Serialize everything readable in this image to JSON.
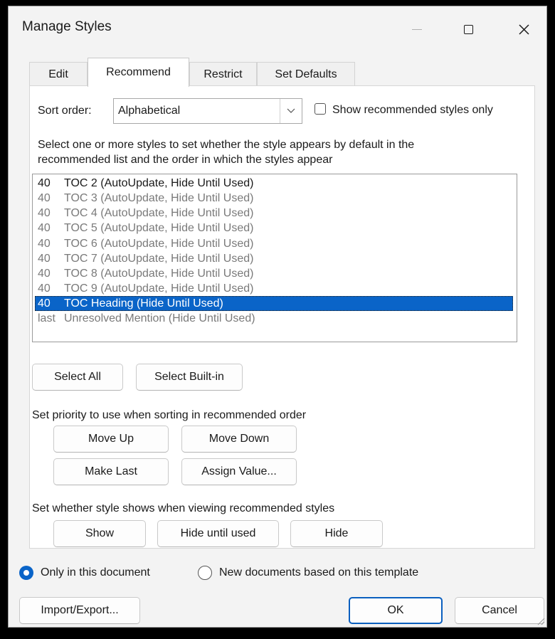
{
  "window": {
    "title": "Manage Styles",
    "controls": {
      "minimize": "minimize-icon",
      "maximize": "maximize-icon",
      "close": "close-icon"
    }
  },
  "tabs": [
    {
      "label": "Edit",
      "active": false
    },
    {
      "label": "Recommend",
      "active": true
    },
    {
      "label": "Restrict",
      "active": false
    },
    {
      "label": "Set Defaults",
      "active": false
    }
  ],
  "sort": {
    "label": "Sort order:",
    "value": "Alphabetical",
    "show_recommended_label": "Show recommended styles only",
    "show_recommended_checked": false
  },
  "instructions": {
    "line1": "Select one or more styles to set whether the style appears by default in the",
    "line2": "recommended list and the order in which the styles appear"
  },
  "styles_list": [
    {
      "priority": "40",
      "name": "TOC 2  (AutoUpdate, Hide Until Used)",
      "state": "normal"
    },
    {
      "priority": "40",
      "name": "TOC 3  (AutoUpdate, Hide Until Used)",
      "state": "dim"
    },
    {
      "priority": "40",
      "name": "TOC 4  (AutoUpdate, Hide Until Used)",
      "state": "dim"
    },
    {
      "priority": "40",
      "name": "TOC 5  (AutoUpdate, Hide Until Used)",
      "state": "dim"
    },
    {
      "priority": "40",
      "name": "TOC 6  (AutoUpdate, Hide Until Used)",
      "state": "dim"
    },
    {
      "priority": "40",
      "name": "TOC 7  (AutoUpdate, Hide Until Used)",
      "state": "dim"
    },
    {
      "priority": "40",
      "name": "TOC 8  (AutoUpdate, Hide Until Used)",
      "state": "dim"
    },
    {
      "priority": "40",
      "name": "TOC 9  (AutoUpdate, Hide Until Used)",
      "state": "dim"
    },
    {
      "priority": "40",
      "name": "TOC Heading  (Hide Until Used)",
      "state": "selected"
    },
    {
      "priority": "last",
      "name": "Unresolved Mention  (Hide Until Used)",
      "state": "dim"
    }
  ],
  "select_buttons": {
    "select_all": "Select All",
    "select_builtin": "Select Built-in"
  },
  "priority_section": {
    "label": "Set priority to use when sorting in recommended order",
    "move_up": "Move Up",
    "move_down": "Move Down",
    "make_last": "Make Last",
    "assign_value": "Assign Value..."
  },
  "visibility_section": {
    "label": "Set whether style shows when viewing recommended styles",
    "show": "Show",
    "hide_until_used": "Hide until used",
    "hide": "Hide"
  },
  "scope": {
    "option1": "Only in this document",
    "option1_selected": true,
    "option2": "New documents based on this template",
    "option2_selected": false
  },
  "footer": {
    "import_export": "Import/Export...",
    "ok": "OK",
    "cancel": "Cancel"
  },
  "colors": {
    "accent": "#0a64c8",
    "selection": "#0a64c8",
    "dim_text": "#7a7a7a"
  }
}
